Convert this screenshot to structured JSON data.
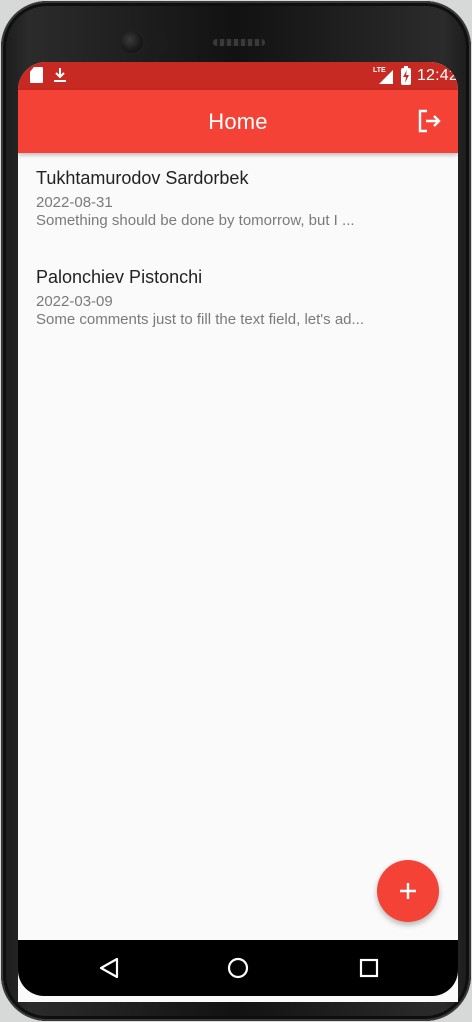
{
  "status_bar": {
    "network": "LTE",
    "time": "12:42"
  },
  "app_bar": {
    "title": "Home",
    "action_icon": "logout-icon"
  },
  "notes": [
    {
      "name": "Tukhtamurodov Sardorbek",
      "date": "2022-08-31",
      "comment": "Something should be done by tomorrow, but I ..."
    },
    {
      "name": "Palonchiev Pistonchi",
      "date": "2022-03-09",
      "comment": "Some comments just to fill the text field, let's ad..."
    }
  ],
  "fab": {
    "icon": "plus-icon"
  },
  "navigation": {
    "back_icon": "back-triangle-icon",
    "home_icon": "home-circle-icon",
    "recents_icon": "recents-square-icon"
  },
  "colors": {
    "primary": "#f44336",
    "status_bar": "#c62a22",
    "background": "#fafafa",
    "title_text": "#222222",
    "secondary_text": "#7a7a7a"
  }
}
